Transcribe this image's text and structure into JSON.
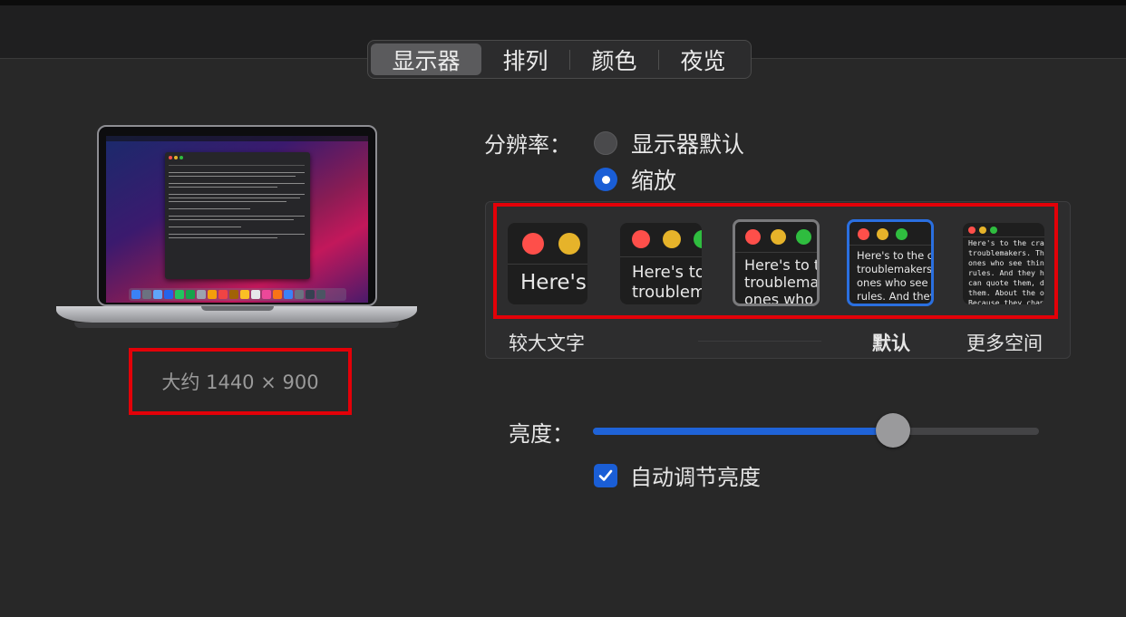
{
  "tabs": [
    {
      "label": "显示器",
      "active": true
    },
    {
      "label": "排列",
      "active": false
    },
    {
      "label": "颜色",
      "active": false
    },
    {
      "label": "夜览",
      "active": false
    }
  ],
  "display": {
    "size_text": "大约 1440 × 900"
  },
  "resolution": {
    "label": "分辨率：",
    "options": [
      {
        "label": "显示器默认",
        "selected": false
      },
      {
        "label": "缩放",
        "selected": true
      }
    ]
  },
  "scale": {
    "previews": [
      {
        "text": "Here's"
      },
      {
        "text": "Here's to\ntroublem"
      },
      {
        "text": "Here's to t\ntroublema\nones who"
      },
      {
        "text": "Here's to the cr\ntroublemakers.\nones who see t\nrules. And they"
      },
      {
        "text": "Here's to the crazy ones\ntroublemakers. The roun\nones who see things dif\nrules. And they have no\ncan quote them, disagre\nthem. About the only th\nBecause they change th"
      }
    ],
    "labels": {
      "larger": "较大文字",
      "default": "默认",
      "more_space": "更多空间"
    },
    "selected_index": 3
  },
  "brightness": {
    "label": "亮度：",
    "value": 0.68,
    "auto_label": "自动调节亮度",
    "auto_checked": true
  },
  "colors": {
    "accent": "#1a5ed6",
    "traffic_red": "#fe4f4a",
    "traffic_yellow": "#e6b32a",
    "traffic_green": "#2fbd3f",
    "highlight_red": "#e30008"
  }
}
